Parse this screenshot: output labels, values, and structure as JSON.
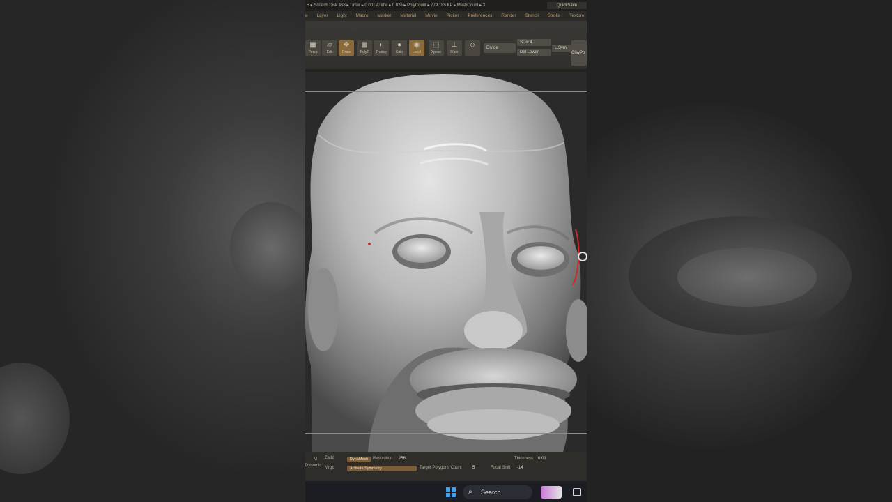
{
  "topbar": {
    "status": "B ▸ Scratch Disk 468 ▸ Timer ▸ 0.001 ATime ▸ 0.026 ▸ PolyCount ▸ 779.185 KP ▸ MeshCount ▸ 3",
    "quicksave": "QuickSave"
  },
  "menu": [
    "e",
    "Layer",
    "Light",
    "Macro",
    "Marker",
    "Material",
    "Movie",
    "Picker",
    "Preferences",
    "Render",
    "Stencil",
    "Stroke",
    "Texture"
  ],
  "toolbar": {
    "persp": "Persp",
    "edit": "Edit",
    "draw": "Draw",
    "polyf": "PolyF",
    "transp": "Transp",
    "solo": "Solo",
    "local": "Local",
    "xpose": "Xpose",
    "floor": "Floor",
    "divide": "Divide",
    "sdiv": "SDiv 4",
    "del_lower": "Del Lower",
    "lsym": "L.Sym",
    "claypolish": "ClayPo"
  },
  "bottom": {
    "m": "M",
    "zadd": "Zadd",
    "dynamic": "Dynamic",
    "mrgb": "Mrgb",
    "dynamesh": "DynaMesh",
    "resolution_label": "Resolution",
    "resolution_value": "256",
    "activate_symmetry": "Activate Symmetry",
    "target_polygons": "Target Polygons Count",
    "target_polygons_value": "5",
    "thickness_label": "Thickness",
    "thickness_value": "0.01",
    "focal_label": "Focal Shift",
    "focal_value": "-14"
  },
  "taskbar": {
    "search_label": "Search"
  }
}
